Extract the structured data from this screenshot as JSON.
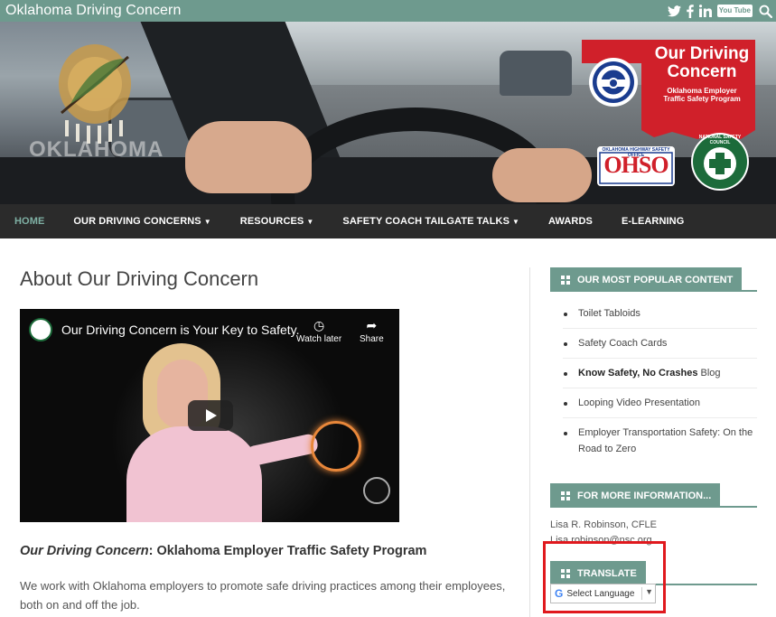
{
  "site": {
    "title": "Oklahoma Driving Concern"
  },
  "social": {
    "twitter": "twitter-icon",
    "facebook": "facebook-icon",
    "linkedin": "linkedin-icon",
    "youtube_label": "You Tube",
    "search": "search-icon"
  },
  "hero": {
    "state_label": "OKLAHOMA",
    "logo_title_line1": "Our Driving",
    "logo_title_line2": "Concern",
    "logo_sub_line1": "Oklahoma Employer",
    "logo_sub_line2": "Traffic Safety Program",
    "ohso_caption": "OKLAHOMA HIGHWAY SAFETY OFFICE",
    "ohso_text": "OHSO",
    "nsc_text": "NATIONAL SAFETY COUNCIL",
    "colors": {
      "logo_red": "#d0202a",
      "nsc_green": "#1c6b3a"
    }
  },
  "nav": {
    "items": [
      {
        "label": "HOME",
        "active": true,
        "has_dropdown": false
      },
      {
        "label": "OUR DRIVING CONCERNS",
        "active": false,
        "has_dropdown": true
      },
      {
        "label": "RESOURCES",
        "active": false,
        "has_dropdown": true
      },
      {
        "label": "SAFETY COACH TAILGATE TALKS",
        "active": false,
        "has_dropdown": true
      },
      {
        "label": "AWARDS",
        "active": false,
        "has_dropdown": false
      },
      {
        "label": "E-LEARNING",
        "active": false,
        "has_dropdown": false
      }
    ]
  },
  "main": {
    "title": "About Our Driving Concern",
    "video": {
      "title": "Our Driving Concern is Your Key to Safety.",
      "watch_later": "Watch later",
      "share": "Share"
    },
    "subtitle_em": "Our Driving Concern",
    "subtitle_rest": ": Oklahoma Employer Traffic Safety Program",
    "paragraph": "We work with Oklahoma employers to promote safe driving practices among their employees, both on and off the job."
  },
  "sidebar": {
    "popular": {
      "heading": "OUR MOST POPULAR CONTENT",
      "items": [
        {
          "bold": "",
          "text": "Toilet Tabloids"
        },
        {
          "bold": "",
          "text": "Safety Coach Cards"
        },
        {
          "bold": "Know Safety, No Crashes",
          "text": " Blog"
        },
        {
          "bold": "",
          "text": "Looping Video Presentation"
        },
        {
          "bold": "",
          "text": "Employer Transportation Safety: On the Road to Zero"
        }
      ]
    },
    "more_info": {
      "heading": "FOR MORE INFORMATION...",
      "name": "Lisa R. Robinson, CFLE",
      "email": "Lisa.robinson@nsc.org"
    },
    "translate": {
      "heading": "TRANSLATE",
      "select_label": "Select Language",
      "google_letter": "G"
    },
    "accent_color": "#6e9a8e"
  }
}
